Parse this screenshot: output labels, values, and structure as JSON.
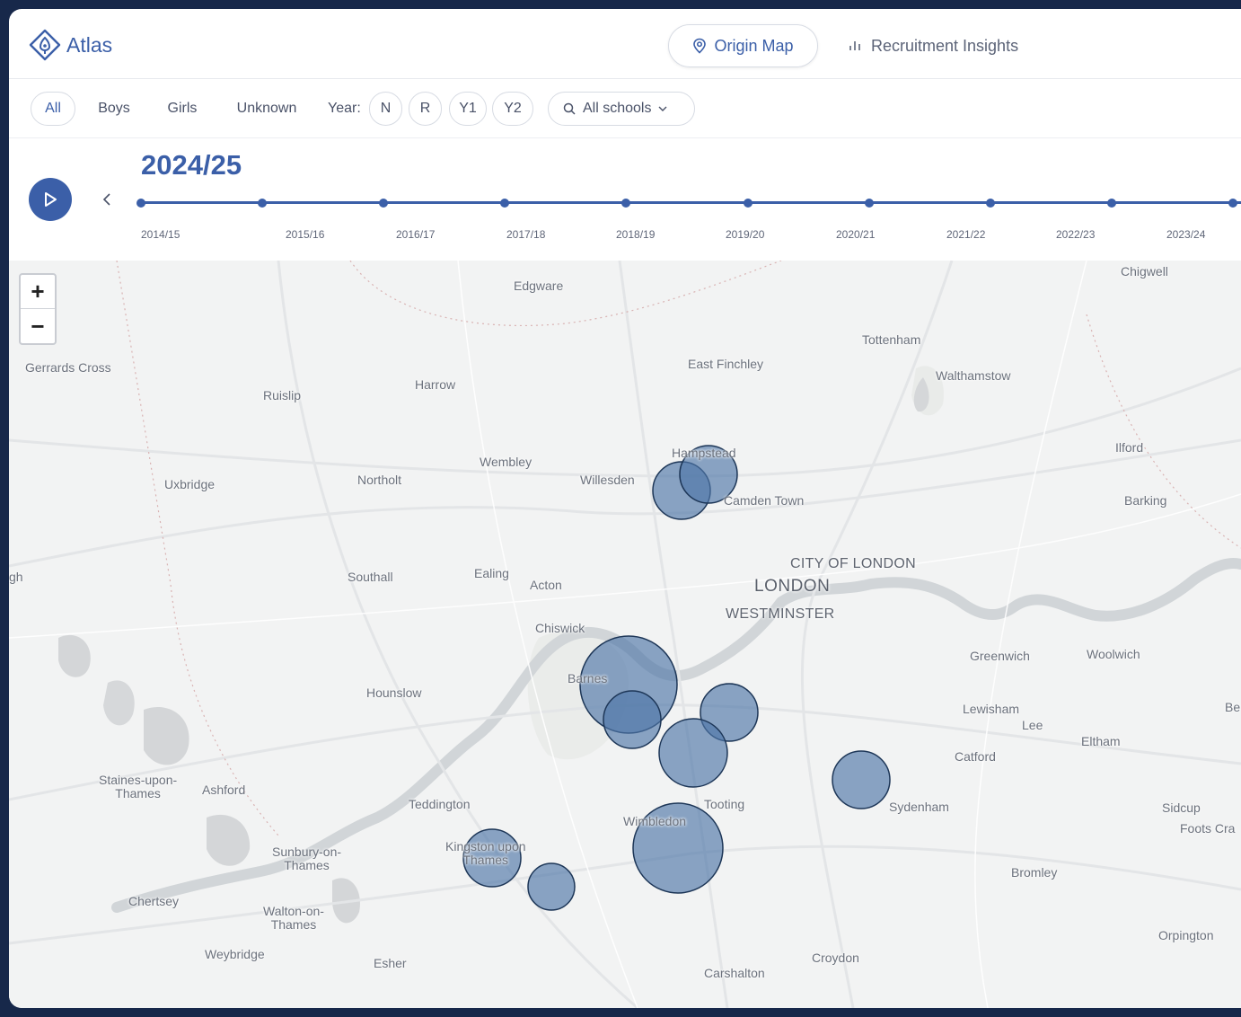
{
  "header": {
    "logo_text": "Atlas",
    "nav": [
      {
        "label": "Origin Map",
        "icon": "map-pin-icon",
        "active": true
      },
      {
        "label": "Recruitment Insights",
        "icon": "bar-chart-icon",
        "active": false
      }
    ]
  },
  "filters": {
    "gender": [
      {
        "label": "All",
        "active": true
      },
      {
        "label": "Boys",
        "active": false
      },
      {
        "label": "Girls",
        "active": false
      },
      {
        "label": "Unknown",
        "active": false
      }
    ],
    "year_label": "Year:",
    "years": [
      "N",
      "R",
      "Y1",
      "Y2"
    ],
    "schools_label": "All schools"
  },
  "timeline": {
    "current": "2024/25",
    "labels": [
      "2014/15",
      "2015/16",
      "2016/17",
      "2017/18",
      "2018/19",
      "2019/20",
      "2020/21",
      "2021/22",
      "2022/23",
      "2023/24"
    ]
  },
  "map": {
    "zoom_in": "+",
    "zoom_out": "−",
    "places": {
      "edgware": "Edgware",
      "chigwell": "Chigwell",
      "tottenham": "Tottenham",
      "east_finchley": "East Finchley",
      "walthamstow": "Walthamstow",
      "gerrards_cross": "Gerrards Cross",
      "ruislip": "Ruislip",
      "harrow": "Harrow",
      "hampstead": "Hampstead",
      "ilford": "Ilford",
      "wembley": "Wembley",
      "willesden": "Willesden",
      "uxbridge": "Uxbridge",
      "northolt": "Northolt",
      "camden_town": "Camden Town",
      "barking": "Barking",
      "city_of_london": "CITY OF LONDON",
      "gh": "gh",
      "southall": "Southall",
      "ealing": "Ealing",
      "acton": "Acton",
      "london": "LONDON",
      "westminster": "WESTMINSTER",
      "chiswick": "Chiswick",
      "greenwich": "Greenwich",
      "woolwich": "Woolwich",
      "barnes": "Barnes",
      "hounslow": "Hounslow",
      "lewisham": "Lewisham",
      "be": "Be",
      "lee": "Lee",
      "eltham": "Eltham",
      "catford": "Catford",
      "staines": "Staines-upon-\nThames",
      "ashford": "Ashford",
      "teddington": "Teddington",
      "tooting": "Tooting",
      "sydenham": "Sydenham",
      "sidcup": "Sidcup",
      "wimbledon": "Wimbledon",
      "foots_cray": "Foots Cra",
      "sunbury": "Sunbury-on-\nThames",
      "kingston": "Kingston upon\nThames",
      "bromley": "Bromley",
      "chertsey": "Chertsey",
      "walton": "Walton-on-\nThames",
      "orpington": "Orpington",
      "weybridge": "Weybridge",
      "esher": "Esher",
      "croydon": "Croydon",
      "carshalton": "Carshalton"
    },
    "bubble_color": "#4e77a8"
  }
}
